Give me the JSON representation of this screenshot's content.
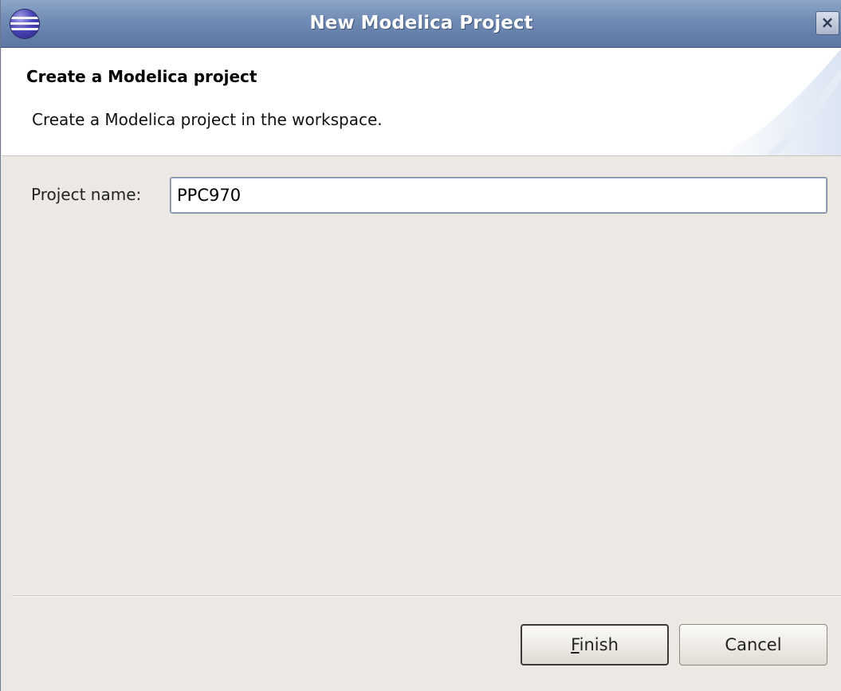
{
  "window": {
    "title": "New Modelica Project",
    "close_glyph": "×",
    "icon": "eclipse-globe-icon"
  },
  "banner": {
    "title": "Create a Modelica project",
    "description": "Create a Modelica project in the workspace."
  },
  "form": {
    "project_name_label": "Project name:",
    "project_name_value": "PPC970"
  },
  "buttons": {
    "finish_mnemonic": "F",
    "finish_rest": "inish",
    "cancel": "Cancel"
  }
}
